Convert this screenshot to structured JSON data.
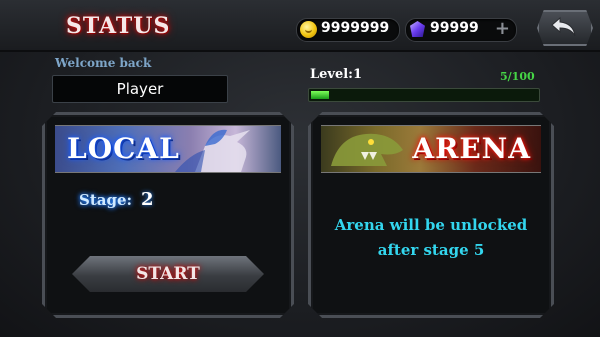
{
  "header": {
    "title": "STATUS",
    "coins": "9999999",
    "gems": "99999",
    "add_symbol": "+"
  },
  "player": {
    "welcome": "Welcome back",
    "name": "Player"
  },
  "level": {
    "label": "Level:1",
    "progress_text": "5/100",
    "progress_fraction": 0.05
  },
  "local": {
    "title": "LOCAL",
    "stage_label": "Stage:",
    "stage_value": "2",
    "start_label": "START"
  },
  "arena": {
    "title": "ARENA",
    "lock_line1": "Arena will be unlocked",
    "lock_line2": "after stage 5"
  },
  "icons": {
    "coin": "coin-icon",
    "gem": "gem-icon",
    "back": "back-arrow-icon"
  },
  "colors": {
    "title_glow": "#d01010",
    "xp_fill": "#46d646",
    "lock_text": "#33d6ee",
    "local_glow": "#1a5cff",
    "arena_glow": "#ff2a1a"
  }
}
